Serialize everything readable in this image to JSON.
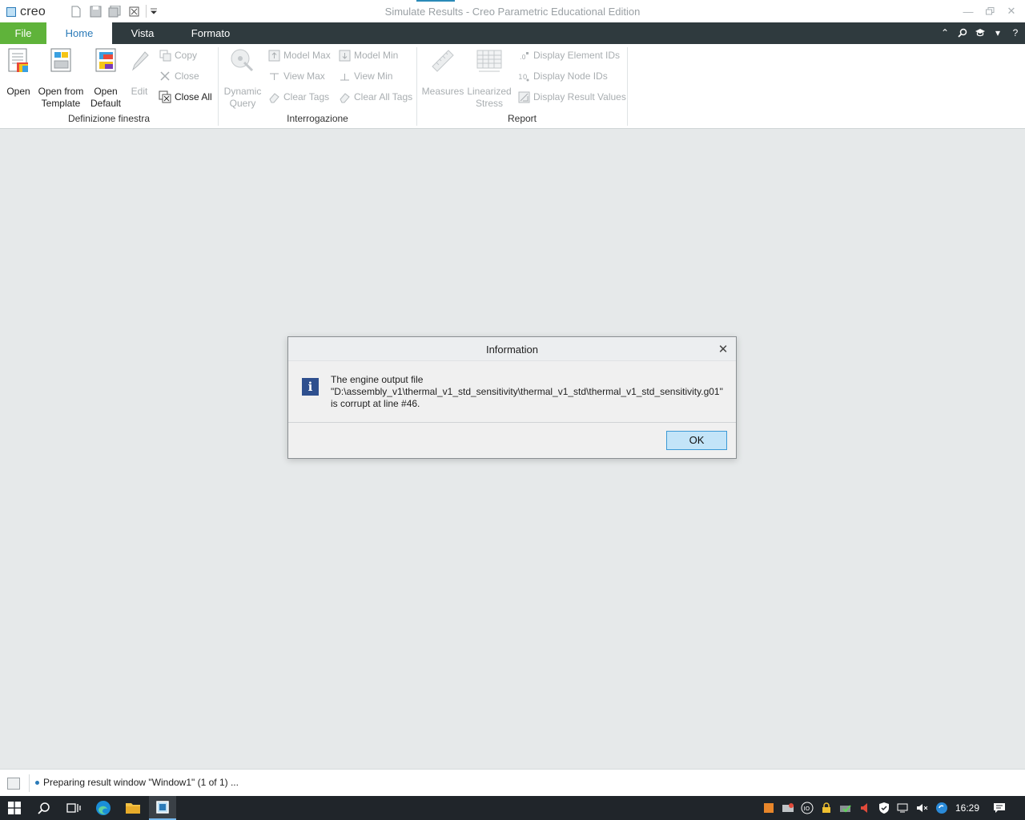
{
  "app": {
    "logo_text": "creo",
    "window_title": "Simulate Results - Creo Parametric Educational Edition"
  },
  "tabs": {
    "file": "File",
    "home": "Home",
    "vista": "Vista",
    "formato": "Formato"
  },
  "ribbon": {
    "groups": {
      "definizione": "Definizione finestra",
      "interrogazione": "Interrogazione",
      "report": "Report"
    },
    "open": "Open",
    "open_template_1": "Open from",
    "open_template_2": "Template",
    "open_default_1": "Open",
    "open_default_2": "Default",
    "edit": "Edit",
    "copy": "Copy",
    "close": "Close",
    "close_all": "Close All",
    "dynamic_query_1": "Dynamic",
    "dynamic_query_2": "Query",
    "model_max": "Model Max",
    "model_min": "Model Min",
    "view_max": "View Max",
    "view_min": "View Min",
    "clear_tags": "Clear Tags",
    "clear_all_tags": "Clear All Tags",
    "measures": "Measures",
    "linearized_1": "Linearized",
    "linearized_2": "Stress",
    "display_element_ids": "Display Element IDs",
    "display_node_ids": "Display Node IDs",
    "display_result_values": "Display Result Values"
  },
  "dialog": {
    "title": "Information",
    "line1": "The engine output file",
    "line2": "\"D:\\assembly_v1\\thermal_v1_std_sensitivity\\thermal_v1_std\\thermal_v1_std_sensitivity.g01\"",
    "line3": "is corrupt at line #46.",
    "ok_label": "OK"
  },
  "status": {
    "message": "Preparing result window \"Window1\" (1 of 1) ..."
  },
  "taskbar": {
    "clock": "16:29"
  }
}
